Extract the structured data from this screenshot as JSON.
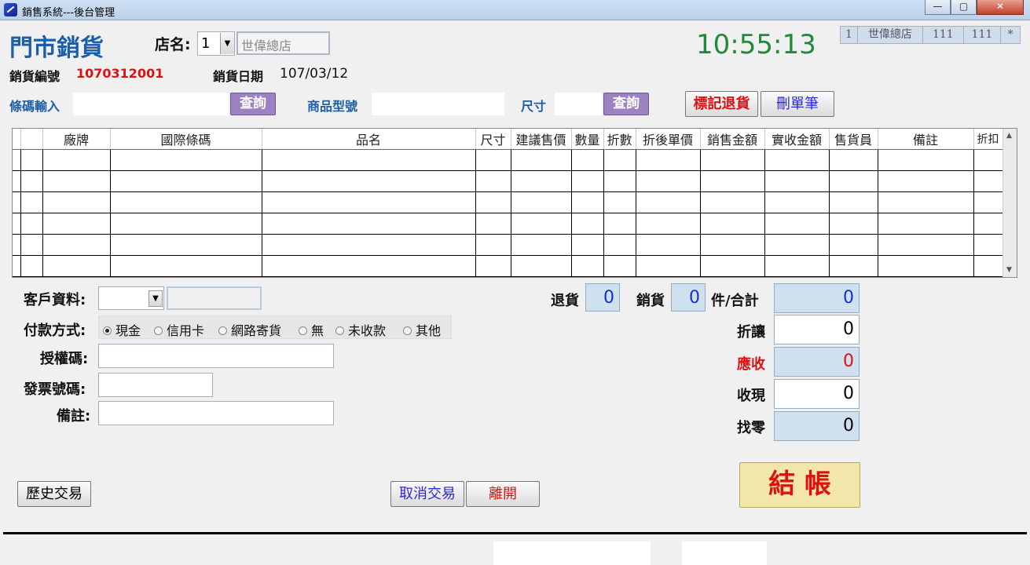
{
  "window": {
    "title": "銷售系統---後台管理",
    "minimize": "—",
    "maximize": "▢",
    "close": "✕"
  },
  "header": {
    "page_title": "門市銷貨",
    "store_label": "店名:",
    "store_no": "1",
    "store_name": "世偉總店",
    "clock": "10:55:13",
    "status_cells": [
      "1",
      "世偉總店",
      "111",
      "111",
      "*"
    ]
  },
  "order": {
    "no_label": "銷貨編號",
    "no_value": "1070312001",
    "date_label": "銷貨日期",
    "date_value": "107/03/12"
  },
  "search": {
    "barcode_label": "條碼輸入",
    "barcode_query": "查詢",
    "model_label": "商品型號",
    "size_label": "尺寸",
    "size_query": "查詢",
    "mark_return": "標記退貨",
    "delete_row": "刪單筆"
  },
  "table": {
    "columns": [
      "",
      "廠牌",
      "國際條碼",
      "品名",
      "尺寸",
      "建議售價",
      "數量",
      "折數",
      "折後單價",
      "銷售金額",
      "實收金額",
      "售貨員",
      "備註",
      "折扣"
    ],
    "rows": 6
  },
  "customer": {
    "label": "客戶資料:"
  },
  "payment": {
    "label": "付款方式:",
    "options": [
      "現金",
      "信用卡",
      "網路寄貨",
      "無",
      "未收款",
      "其他"
    ],
    "selected": "現金"
  },
  "auth": {
    "label": "授權碼:"
  },
  "invoice": {
    "label": "發票號碼:"
  },
  "remark": {
    "label": "備註:"
  },
  "counters": {
    "return_label": "退貨",
    "return_value": "0",
    "sale_label": "銷貨",
    "sale_value": "0"
  },
  "totals": {
    "count_label": "件/合計",
    "count_value": "0",
    "discount_label": "折讓",
    "discount_value": "0",
    "receivable_label": "應收",
    "receivable_value": "0",
    "received_label": "收現",
    "received_value": "0",
    "change_label": "找零",
    "change_value": "0"
  },
  "actions": {
    "history": "歷史交易",
    "cancel": "取消交易",
    "leave": "離開",
    "checkout": "結 帳"
  },
  "colors": {
    "accent_blue": "#1c5fa8",
    "clock_green": "#1f8a3a",
    "red": "#e01010",
    "value_blue": "#1030d0",
    "checkout_bg": "#f2e6a8"
  }
}
